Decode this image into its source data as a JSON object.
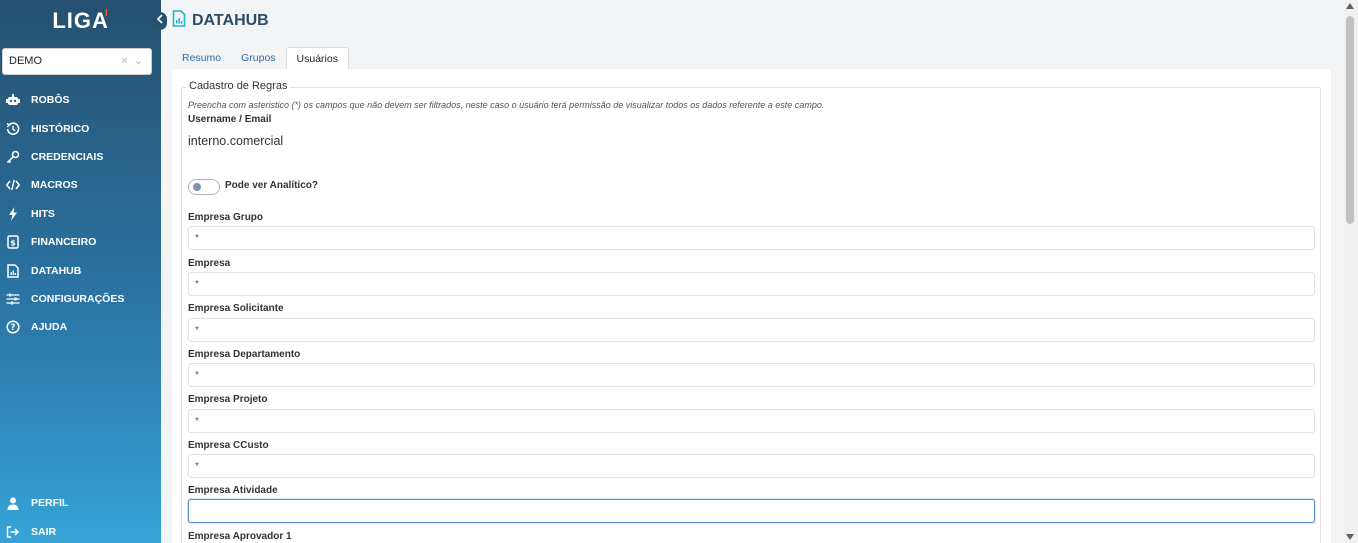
{
  "brand": {
    "logo_text": "LIGA",
    "logo_mark": "I"
  },
  "sidebar": {
    "tenant": {
      "value": "DEMO",
      "clear": "×",
      "caret": "⌄"
    },
    "items": [
      {
        "label": "ROBÔS"
      },
      {
        "label": "HISTÓRICO"
      },
      {
        "label": "CREDENCIAIS"
      },
      {
        "label": "MACROS"
      },
      {
        "label": "HITS"
      },
      {
        "label": "FINANCEIRO"
      },
      {
        "label": "DATAHUB"
      },
      {
        "label": "CONFIGURAÇÕES"
      },
      {
        "label": "AJUDA"
      }
    ],
    "bottom_items": [
      {
        "label": "PERFIL"
      },
      {
        "label": "SAIR"
      }
    ]
  },
  "header": {
    "title": "DATAHUB"
  },
  "tabs": [
    {
      "label": "Resumo"
    },
    {
      "label": "Grupos"
    },
    {
      "label": "Usuários"
    }
  ],
  "form": {
    "legend": "Cadastro de Regras",
    "help": "Preencha com asteristico (*) os campos que não devem ser filtrados, neste caso o usuário terá permissão de visualizar todos os dados referente a este campo.",
    "username_label": "Username / Email",
    "username_value": "interno.comercial",
    "toggle_label": "Pode ver Analítico?",
    "fields": [
      {
        "label": "Empresa Grupo",
        "value": "*"
      },
      {
        "label": "Empresa",
        "value": "*"
      },
      {
        "label": "Empresa Solicitante",
        "value": "*"
      },
      {
        "label": "Empresa Departamento",
        "value": "*"
      },
      {
        "label": "Empresa Projeto",
        "value": "*"
      },
      {
        "label": "Empresa CCusto",
        "value": "*"
      },
      {
        "label": "Empresa Atividade",
        "value": ""
      },
      {
        "label": "Empresa Aprovador 1",
        "value": ""
      }
    ]
  },
  "colors": {
    "sidebar_top": "#26506f",
    "sidebar_bottom": "#36a3d6",
    "accent": "#f15a2b",
    "link": "#2f6ea5",
    "title": "#2b4c68",
    "icon_teal": "#1fb5c9"
  }
}
